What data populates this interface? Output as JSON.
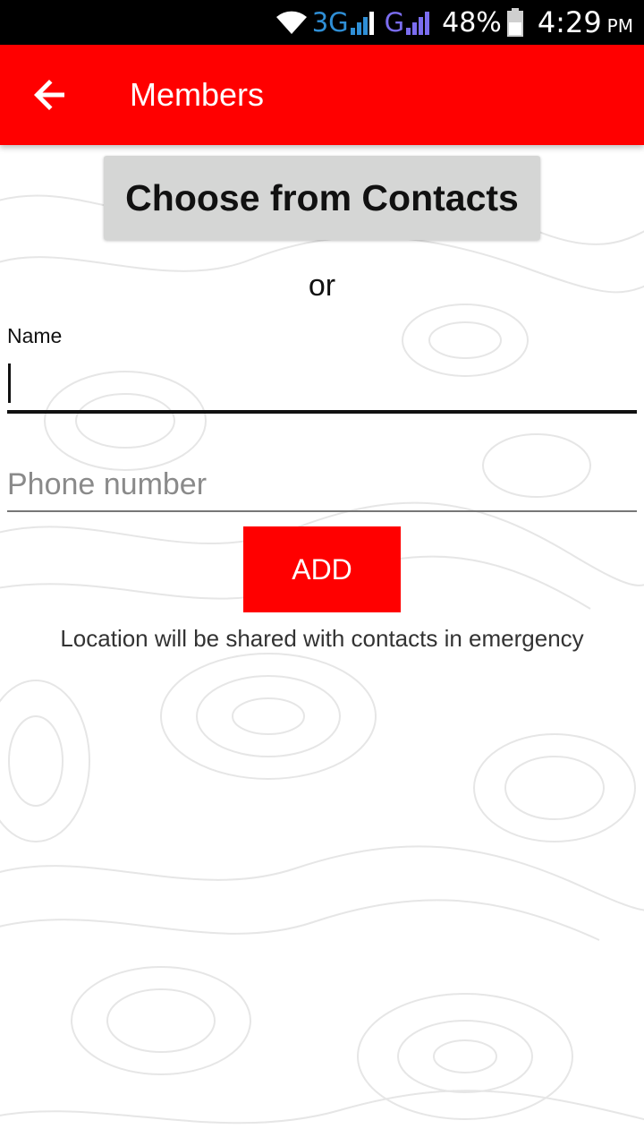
{
  "status_bar": {
    "network_3g": "3G",
    "network_g": "G",
    "battery_percent": "48%",
    "time": "4:29",
    "ampm": "PM",
    "icons": [
      "wifi-icon",
      "signal-3g-icon",
      "signal-g-icon",
      "battery-icon"
    ]
  },
  "app_bar": {
    "title": "Members",
    "back_icon": "arrow-back-icon",
    "background_color": "#ff0000"
  },
  "form": {
    "contacts_button_label": "Choose from Contacts",
    "or_text": "or",
    "name_label": "Name",
    "name_value": "",
    "phone_placeholder": "Phone number",
    "add_button_label": "ADD",
    "info_text": "Location will be shared with contacts in emergency"
  }
}
